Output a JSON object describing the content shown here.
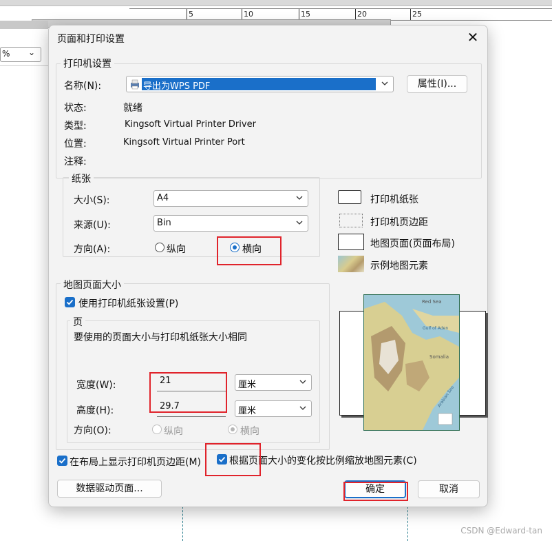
{
  "background": {
    "ruler_labels": [
      "5",
      "10",
      "15",
      "20",
      "25"
    ],
    "combo_text": "%",
    "watermark": "CSDN @Edward-tan"
  },
  "dialog": {
    "title": "页面和打印设置",
    "printer": {
      "legend": "打印机设置",
      "name_label": "名称(N):",
      "name_value": "导出为WPS PDF",
      "properties_button": "属性(I)...",
      "status_label": "状态:",
      "status_value": "就绪",
      "type_label": "类型:",
      "type_value": "Kingsoft Virtual Printer Driver",
      "location_label": "位置:",
      "location_value": "Kingsoft Virtual Printer Port",
      "comment_label": "注释:"
    },
    "paper": {
      "legend": "纸张",
      "size_label": "大小(S):",
      "size_value": "A4",
      "source_label": "来源(U):",
      "source_value": "Bin",
      "orientation_label": "方向(A):",
      "portrait": "纵向",
      "landscape": "横向",
      "selected": "landscape"
    },
    "legend_items": [
      {
        "icon": "printer-paper-icon",
        "label": "打印机纸张"
      },
      {
        "icon": "printer-margin-icon",
        "label": "打印机页边距"
      },
      {
        "icon": "map-page-icon",
        "label": "地图页面(页面布局)"
      },
      {
        "icon": "sample-map-icon",
        "label": "示例地图元素"
      }
    ],
    "map_page": {
      "legend": "地图页面大小",
      "use_printer_paper_label": "使用打印机纸张设置(P)",
      "use_printer_paper_checked": true,
      "page_legend": "页",
      "page_desc": "要使用的页面大小与打印机纸张大小相同",
      "width_label": "宽度(W):",
      "width_value": "21",
      "width_unit": "厘米",
      "height_label": "高度(H):",
      "height_value": "29.7",
      "height_unit": "厘米",
      "orientation_label": "方向(O):",
      "portrait": "纵向",
      "landscape": "横向"
    },
    "show_margins_label": "在布局上显示打印机页边距(M)",
    "scale_elements_label": "根据页面大小的变化按比例缩放地图元素(C)",
    "data_driven_button": "数据驱动页面...",
    "ok_button": "确定",
    "cancel_button": "取消",
    "preview_map_labels": [
      "Red Sea",
      "Gulf of Aden",
      "Somalia",
      "Arabian Sea"
    ]
  },
  "colors": {
    "accent": "#1a6fc9",
    "highlight": "#e0232b",
    "dialog_bg": "#f3f3f3"
  }
}
